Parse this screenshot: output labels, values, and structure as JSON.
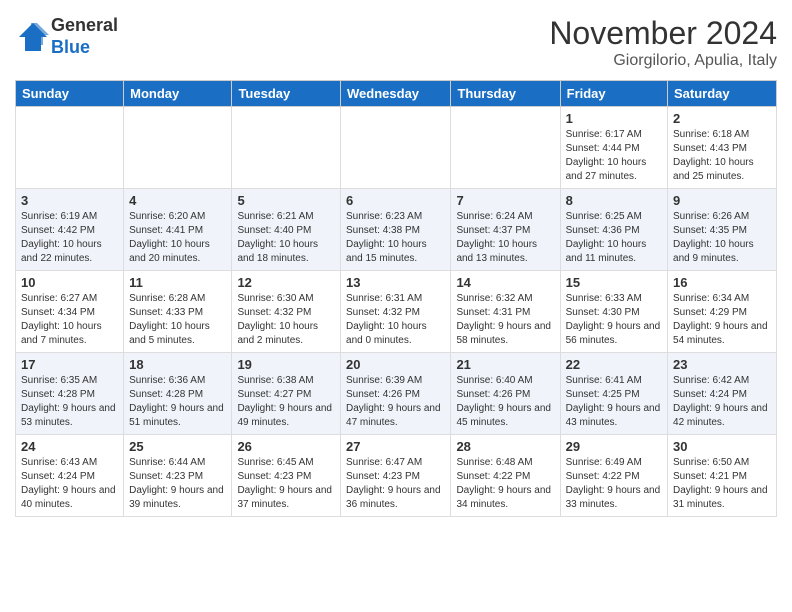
{
  "logo": {
    "general": "General",
    "blue": "Blue"
  },
  "header": {
    "month": "November 2024",
    "location": "Giorgilorio, Apulia, Italy"
  },
  "days_of_week": [
    "Sunday",
    "Monday",
    "Tuesday",
    "Wednesday",
    "Thursday",
    "Friday",
    "Saturday"
  ],
  "weeks": [
    [
      {
        "day": "",
        "info": ""
      },
      {
        "day": "",
        "info": ""
      },
      {
        "day": "",
        "info": ""
      },
      {
        "day": "",
        "info": ""
      },
      {
        "day": "",
        "info": ""
      },
      {
        "day": "1",
        "info": "Sunrise: 6:17 AM\nSunset: 4:44 PM\nDaylight: 10 hours and 27 minutes."
      },
      {
        "day": "2",
        "info": "Sunrise: 6:18 AM\nSunset: 4:43 PM\nDaylight: 10 hours and 25 minutes."
      }
    ],
    [
      {
        "day": "3",
        "info": "Sunrise: 6:19 AM\nSunset: 4:42 PM\nDaylight: 10 hours and 22 minutes."
      },
      {
        "day": "4",
        "info": "Sunrise: 6:20 AM\nSunset: 4:41 PM\nDaylight: 10 hours and 20 minutes."
      },
      {
        "day": "5",
        "info": "Sunrise: 6:21 AM\nSunset: 4:40 PM\nDaylight: 10 hours and 18 minutes."
      },
      {
        "day": "6",
        "info": "Sunrise: 6:23 AM\nSunset: 4:38 PM\nDaylight: 10 hours and 15 minutes."
      },
      {
        "day": "7",
        "info": "Sunrise: 6:24 AM\nSunset: 4:37 PM\nDaylight: 10 hours and 13 minutes."
      },
      {
        "day": "8",
        "info": "Sunrise: 6:25 AM\nSunset: 4:36 PM\nDaylight: 10 hours and 11 minutes."
      },
      {
        "day": "9",
        "info": "Sunrise: 6:26 AM\nSunset: 4:35 PM\nDaylight: 10 hours and 9 minutes."
      }
    ],
    [
      {
        "day": "10",
        "info": "Sunrise: 6:27 AM\nSunset: 4:34 PM\nDaylight: 10 hours and 7 minutes."
      },
      {
        "day": "11",
        "info": "Sunrise: 6:28 AM\nSunset: 4:33 PM\nDaylight: 10 hours and 5 minutes."
      },
      {
        "day": "12",
        "info": "Sunrise: 6:30 AM\nSunset: 4:32 PM\nDaylight: 10 hours and 2 minutes."
      },
      {
        "day": "13",
        "info": "Sunrise: 6:31 AM\nSunset: 4:32 PM\nDaylight: 10 hours and 0 minutes."
      },
      {
        "day": "14",
        "info": "Sunrise: 6:32 AM\nSunset: 4:31 PM\nDaylight: 9 hours and 58 minutes."
      },
      {
        "day": "15",
        "info": "Sunrise: 6:33 AM\nSunset: 4:30 PM\nDaylight: 9 hours and 56 minutes."
      },
      {
        "day": "16",
        "info": "Sunrise: 6:34 AM\nSunset: 4:29 PM\nDaylight: 9 hours and 54 minutes."
      }
    ],
    [
      {
        "day": "17",
        "info": "Sunrise: 6:35 AM\nSunset: 4:28 PM\nDaylight: 9 hours and 53 minutes."
      },
      {
        "day": "18",
        "info": "Sunrise: 6:36 AM\nSunset: 4:28 PM\nDaylight: 9 hours and 51 minutes."
      },
      {
        "day": "19",
        "info": "Sunrise: 6:38 AM\nSunset: 4:27 PM\nDaylight: 9 hours and 49 minutes."
      },
      {
        "day": "20",
        "info": "Sunrise: 6:39 AM\nSunset: 4:26 PM\nDaylight: 9 hours and 47 minutes."
      },
      {
        "day": "21",
        "info": "Sunrise: 6:40 AM\nSunset: 4:26 PM\nDaylight: 9 hours and 45 minutes."
      },
      {
        "day": "22",
        "info": "Sunrise: 6:41 AM\nSunset: 4:25 PM\nDaylight: 9 hours and 43 minutes."
      },
      {
        "day": "23",
        "info": "Sunrise: 6:42 AM\nSunset: 4:24 PM\nDaylight: 9 hours and 42 minutes."
      }
    ],
    [
      {
        "day": "24",
        "info": "Sunrise: 6:43 AM\nSunset: 4:24 PM\nDaylight: 9 hours and 40 minutes."
      },
      {
        "day": "25",
        "info": "Sunrise: 6:44 AM\nSunset: 4:23 PM\nDaylight: 9 hours and 39 minutes."
      },
      {
        "day": "26",
        "info": "Sunrise: 6:45 AM\nSunset: 4:23 PM\nDaylight: 9 hours and 37 minutes."
      },
      {
        "day": "27",
        "info": "Sunrise: 6:47 AM\nSunset: 4:23 PM\nDaylight: 9 hours and 36 minutes."
      },
      {
        "day": "28",
        "info": "Sunrise: 6:48 AM\nSunset: 4:22 PM\nDaylight: 9 hours and 34 minutes."
      },
      {
        "day": "29",
        "info": "Sunrise: 6:49 AM\nSunset: 4:22 PM\nDaylight: 9 hours and 33 minutes."
      },
      {
        "day": "30",
        "info": "Sunrise: 6:50 AM\nSunset: 4:21 PM\nDaylight: 9 hours and 31 minutes."
      }
    ]
  ]
}
